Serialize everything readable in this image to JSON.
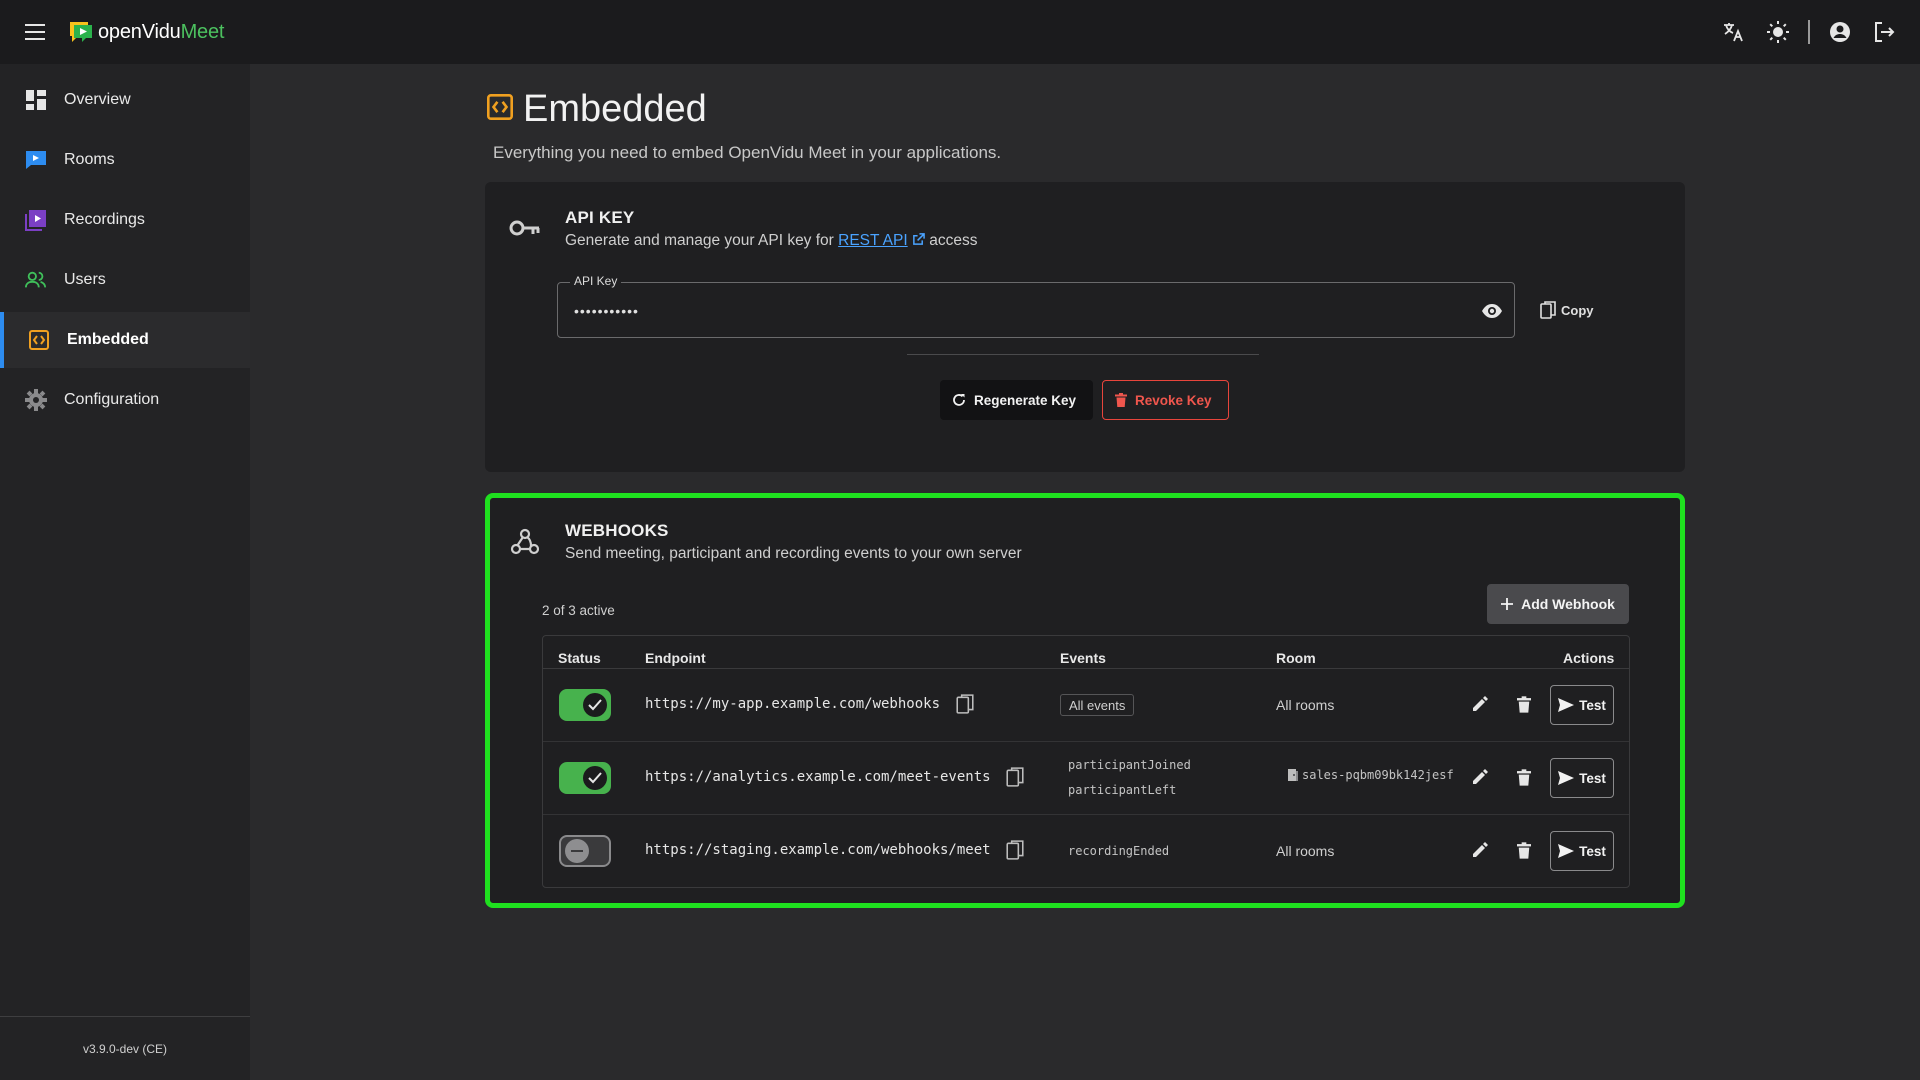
{
  "app": {
    "logo_part1": "openVidu",
    "logo_part2": "Meet",
    "icons": [
      "menu-icon",
      "translate-icon",
      "brightness-icon",
      "account-icon",
      "logout-icon"
    ]
  },
  "sidebar": {
    "items": [
      {
        "label": "Overview",
        "icon": "dashboard-icon"
      },
      {
        "label": "Rooms",
        "icon": "chat-icon"
      },
      {
        "label": "Recordings",
        "icon": "video-library-icon"
      },
      {
        "label": "Users",
        "icon": "users-icon"
      },
      {
        "label": "Embedded",
        "icon": "code-icon",
        "active": true
      },
      {
        "label": "Configuration",
        "icon": "gear-icon"
      }
    ],
    "version": "v3.9.0-dev (CE)"
  },
  "page": {
    "title": "Embedded",
    "subtitle": "Everything you need to embed OpenVidu Meet in your applications."
  },
  "api_key": {
    "title": "API KEY",
    "desc_before": "Generate and manage your API key for ",
    "desc_link": "REST API",
    "desc_after": " access",
    "field_label": "API Key",
    "field_value": "•••••••••••",
    "copy_label": "Copy",
    "regenerate_label": "Regenerate Key",
    "revoke_label": "Revoke Key"
  },
  "webhooks": {
    "title": "WEBHOOKS",
    "desc": "Send meeting, participant and recording events to your own server",
    "active_count": "2 of 3 active",
    "add_label": "Add Webhook",
    "columns": [
      "Status",
      "Endpoint",
      "Events",
      "Room",
      "Actions"
    ],
    "test_label": "Test",
    "rows": [
      {
        "enabled": true,
        "endpoint": "https://my-app.example.com/webhooks",
        "events": [
          "All events"
        ],
        "events_is_chip": true,
        "room": "All rooms"
      },
      {
        "enabled": true,
        "endpoint": "https://analytics.example.com/meet-events",
        "events": [
          "participantJoined",
          "participantLeft"
        ],
        "events_is_chip": false,
        "room": "sales-pqbm09bk142jesf"
      },
      {
        "enabled": false,
        "endpoint": "https://staging.example.com/webhooks/meet",
        "events": [
          "recordingEnded"
        ],
        "events_is_chip": false,
        "room": "All rooms"
      }
    ]
  },
  "colors": {
    "accent_orange": "#f0a020",
    "toggle_on": "#47b24d",
    "danger": "#f0564d",
    "link": "#4aa3ff",
    "highlight": "#1fe01f"
  }
}
